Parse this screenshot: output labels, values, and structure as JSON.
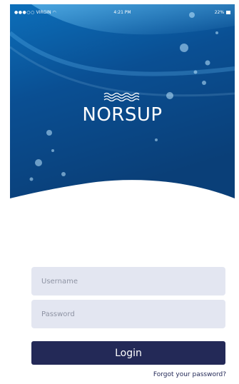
{
  "status_bar": {
    "carrier": "VIRGIN",
    "signal_dots": "●●●○○",
    "wifi_icon": "wifi-icon",
    "time": "4:21 PM",
    "battery": "22%",
    "battery_icon": "battery-icon"
  },
  "hero": {
    "logo_icon": "waves-icon",
    "brand_name": "NORSUP",
    "background_top": "#0b5fa5",
    "background_bottom": "#0a3f76"
  },
  "form": {
    "username_placeholder": "Username",
    "username_value": "",
    "password_placeholder": "Password",
    "password_value": "",
    "login_label": "Login",
    "forgot_password": "Forgot your password?"
  },
  "colors": {
    "field_background": "#e3e6f1",
    "button_background": "#232957",
    "text_dark": "#232957"
  }
}
